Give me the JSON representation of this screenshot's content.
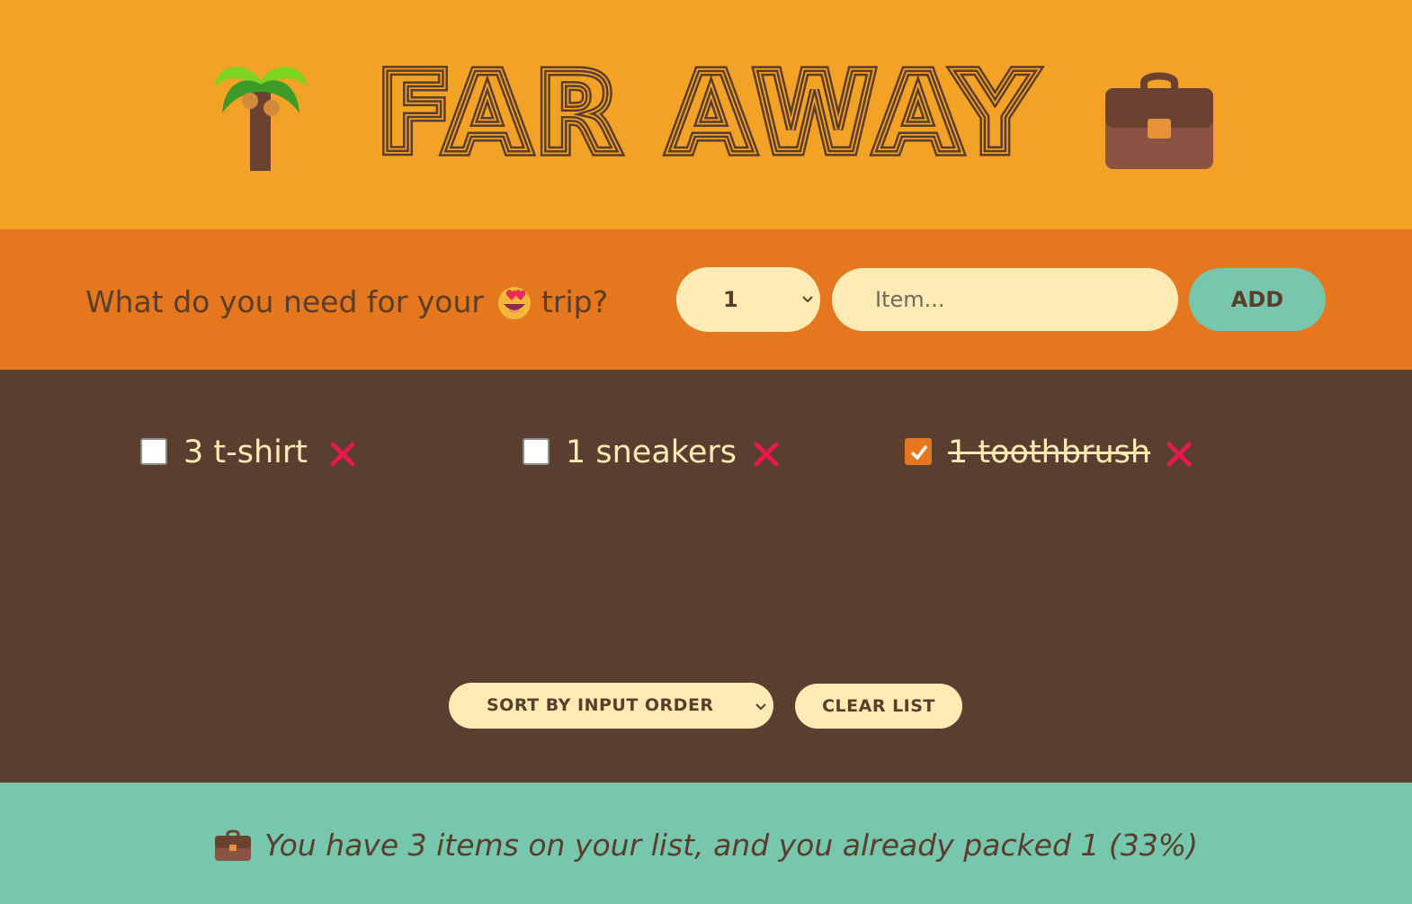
{
  "header": {
    "title": "FAR AWAY",
    "left_icon": "palm-tree-icon",
    "right_icon": "briefcase-icon"
  },
  "form": {
    "question_prefix": "What do you need for your",
    "question_emoji": "heart-eyes-icon",
    "question_suffix": "trip?",
    "quantity_selected": "1",
    "item_placeholder": "Item...",
    "add_label": "ADD"
  },
  "items": [
    {
      "label": "3 t-shirt",
      "packed": false
    },
    {
      "label": "1 sneakers",
      "packed": false
    },
    {
      "label": "1 toothbrush",
      "packed": true
    }
  ],
  "actions": {
    "sort_selected": "SORT BY INPUT ORDER",
    "clear_label": "CLEAR LIST"
  },
  "stats": {
    "icon": "briefcase-icon",
    "text": "You have 3 items on your list, and you already packed 1 (33%)"
  },
  "colors": {
    "header_bg": "#f4a226",
    "form_bg": "#e5771e",
    "list_bg": "#5a3e2f",
    "stats_bg": "#76c7ad",
    "cream": "#ffebb3",
    "brown_text": "#5a3e2b",
    "delete_red": "#e5194f"
  }
}
